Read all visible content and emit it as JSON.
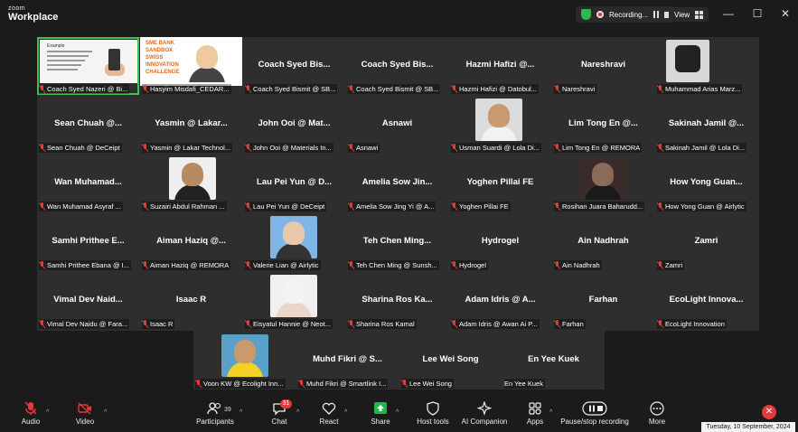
{
  "app": {
    "brand_small": "zoom",
    "brand_big": "Workplace"
  },
  "status": {
    "recording_label": "Recording...",
    "view_label": "View"
  },
  "window_controls": {
    "minimize": "—",
    "maximize": "☐",
    "close": "✕"
  },
  "tiles": [
    {
      "big": "",
      "label": "Coach Syed Nazeri @ Bi..."
    },
    {
      "big": "",
      "label": "Hasyim Misdafi_CEDAR..."
    },
    {
      "big": "Coach Syed Bis...",
      "label": "Coach Syed Bismit @ SB..."
    },
    {
      "big": "Coach Syed Bis...",
      "label": "Coach Syed Bismit @ SB..."
    },
    {
      "big": "Hazmi Hafizi @...",
      "label": "Hazmi Hafizi @ Datobul..."
    },
    {
      "big": "Nareshravi",
      "label": "Nareshravi"
    },
    {
      "big": "",
      "label": "Muhammad Arias Marz..."
    },
    {
      "big": "Sean Chuah @...",
      "label": "Sean Chuah @ DeCeipt"
    },
    {
      "big": "Yasmin @ Lakar...",
      "label": "Yasmin @ Lakar Technol..."
    },
    {
      "big": "John Ooi @ Mat...",
      "label": "John Ooi @ Materials In..."
    },
    {
      "big": "Asnawi",
      "label": "Asnawi"
    },
    {
      "big": "",
      "label": "Usman Suardi @ Lola Di..."
    },
    {
      "big": "Lim Tong En @...",
      "label": "Lim Tong En @ REMORA"
    },
    {
      "big": "Sakinah Jamil @...",
      "label": "Sakinah Jamil @ Lola Di..."
    },
    {
      "big": "Wan Muhamad...",
      "label": "Wan Muhamad Asyraf ..."
    },
    {
      "big": "",
      "label": "Suzairi Abdul Rahman ..."
    },
    {
      "big": "Lau Pei Yun @ D...",
      "label": "Lau Pei Yun @ DeCeipt"
    },
    {
      "big": "Amelia Sow Jin...",
      "label": "Amelia Sow Jing Yi @ A..."
    },
    {
      "big": "Yoghen Pillai FE",
      "label": "Yoghen Pillai FE"
    },
    {
      "big": "",
      "label": "Rosihan Juara Baharudd..."
    },
    {
      "big": "How Yong Guan...",
      "label": "How Yong Guan @ Airlytic"
    },
    {
      "big": "Samhi Prithee E...",
      "label": "Samhi Prithee Ebana @ I..."
    },
    {
      "big": "Aiman Haziq @...",
      "label": "Aiman Haziq @ REMORA"
    },
    {
      "big": "",
      "label": "Valerie Lian @ Airlytic"
    },
    {
      "big": "Teh Chen Ming...",
      "label": "Teh Chen Ming @ Sunsh..."
    },
    {
      "big": "Hydrogel",
      "label": "Hydrogel"
    },
    {
      "big": "Ain Nadhrah",
      "label": "Ain Nadhrah"
    },
    {
      "big": "Zamri",
      "label": "Zamri"
    },
    {
      "big": "Vimal Dev Naid...",
      "label": "Vimal Dev Naidu @ Fara..."
    },
    {
      "big": "Isaac R",
      "label": "Isaac R"
    },
    {
      "big": "",
      "label": "Eisyatul Hannie @ Neot..."
    },
    {
      "big": "Sharina Ros Ka...",
      "label": "Sharina Ros Kamal"
    },
    {
      "big": "Adam Idris @ A...",
      "label": "Adam Idris @ Awan Ai P..."
    },
    {
      "big": "Farhan",
      "label": "Farhan"
    },
    {
      "big": "EcoLight Innova...",
      "label": "EcoLight Innovation"
    }
  ],
  "bottom_tiles": [
    {
      "big": "",
      "label": "Voon KW @ Ecolight Inn..."
    },
    {
      "big": "Muhd Fikri @ S...",
      "label": "Muhd Fikri @ Smartlink I..."
    },
    {
      "big": "Lee Wei Song",
      "label": "Lee Wei Song"
    },
    {
      "big": "En Yee Kuek",
      "label": "En Yee Kuek"
    }
  ],
  "slide": {
    "title": "Example"
  },
  "banner": {
    "line1": "SME BANK",
    "line2": "SANDBOX",
    "line3": "SWISS",
    "line4": "INNOVATION",
    "line5": "CHALLENGE"
  },
  "toolbar": {
    "audio": "Audio",
    "video": "Video",
    "participants": "Participants",
    "participants_count": "39",
    "chat": "Chat",
    "chat_badge": "31",
    "react": "React",
    "share": "Share",
    "host_tools": "Host tools",
    "ai_companion": "AI Companion",
    "apps": "Apps",
    "pause_stop": "Pause/stop recording",
    "more": "More"
  },
  "datetime": "Tuesday, 10 September, 2024",
  "colors": {
    "accent_green": "#3fc04a",
    "muted_red": "#e23b3b",
    "share_green": "#1fb84a",
    "tile_bg": "#2e2e2e"
  }
}
